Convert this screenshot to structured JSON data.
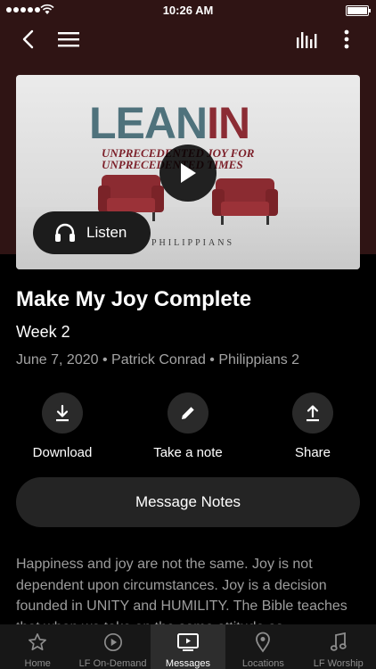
{
  "status_bar": {
    "time": "10:26 AM"
  },
  "hero": {
    "title_part1": "LEAN",
    "title_part2": "IN",
    "tagline_line1": "UNPRECEDENTED JOY FOR",
    "tagline_line2": "UNPRECEDENTED TIMES",
    "book": "PHILIPPIANS",
    "listen_label": "Listen"
  },
  "message": {
    "title": "Make My Joy Complete",
    "subtitle": "Week 2",
    "meta": "June 7, 2020 • Patrick Conrad • Philippians 2"
  },
  "actions": {
    "download": "Download",
    "note": "Take a note",
    "share": "Share"
  },
  "notes_button": "Message Notes",
  "description": "Happiness and joy are not the same. Joy is not dependent upon circumstances. Joy is a decision founded in UNITY and HUMILITY.  The Bible teaches that when we take on the same attitude as",
  "tabs": [
    {
      "label": "Home",
      "icon": "star-icon"
    },
    {
      "label": "LF On-Demand",
      "icon": "play-circle-icon"
    },
    {
      "label": "Messages",
      "icon": "tv-play-icon"
    },
    {
      "label": "Locations",
      "icon": "map-pin-icon"
    },
    {
      "label": "LF Worship",
      "icon": "music-note-icon"
    }
  ],
  "colors": {
    "header_bg": "#2f1414",
    "background": "#000000",
    "accent_red": "#8b2c34",
    "accent_teal": "#4f727c"
  }
}
